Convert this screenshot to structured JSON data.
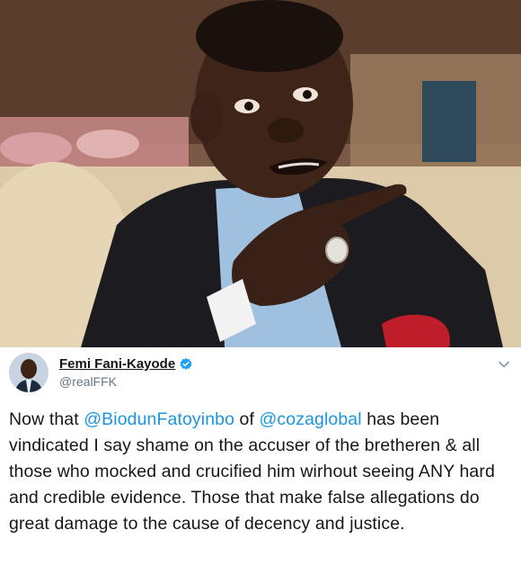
{
  "tweet": {
    "display_name": "Femi Fani-Kayode",
    "handle": "@realFFK",
    "text_1": "Now that ",
    "mention_1": "@BiodunFatoyinbo",
    "text_2": " of ",
    "mention_2": "@cozaglobal",
    "text_3": " has been vindicated I say shame on the accuser of the bretheren & all those who mocked and crucified him wirhout seeing ANY hard and credible evidence. Those that make false allegations do great damage to the cause of decency and justice."
  },
  "icons": {
    "verified": "verified-badge-icon",
    "menu": "chevron-down-icon"
  },
  "colors": {
    "link": "#1b95e0",
    "text": "#14171a",
    "secondary": "#657786",
    "verified": "#1da1f2"
  }
}
